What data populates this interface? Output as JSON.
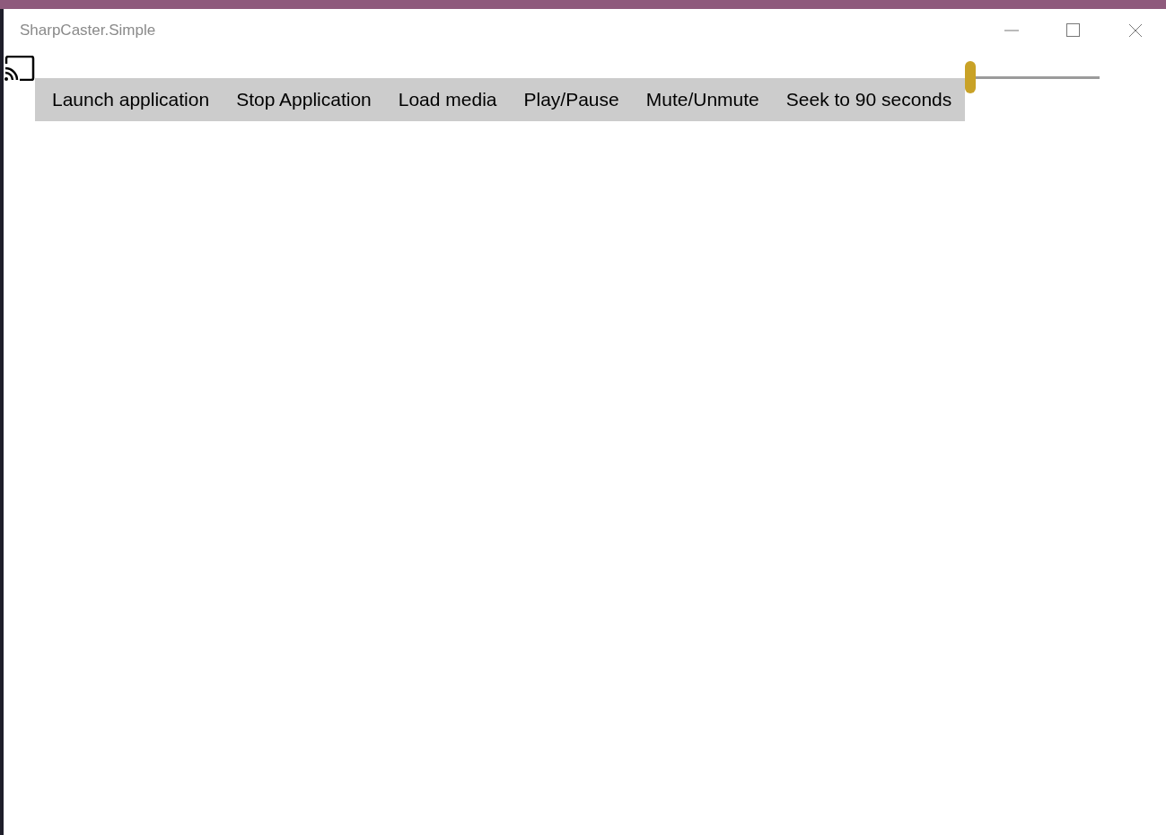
{
  "window": {
    "title": "SharpCaster.Simple"
  },
  "toolbar": {
    "buttons": [
      {
        "label": "Launch application"
      },
      {
        "label": "Stop Application"
      },
      {
        "label": "Load media"
      },
      {
        "label": "Play/Pause"
      },
      {
        "label": "Mute/Unmute"
      },
      {
        "label": "Seek to 90 seconds"
      }
    ]
  },
  "volume_slider": {
    "level": 0
  }
}
